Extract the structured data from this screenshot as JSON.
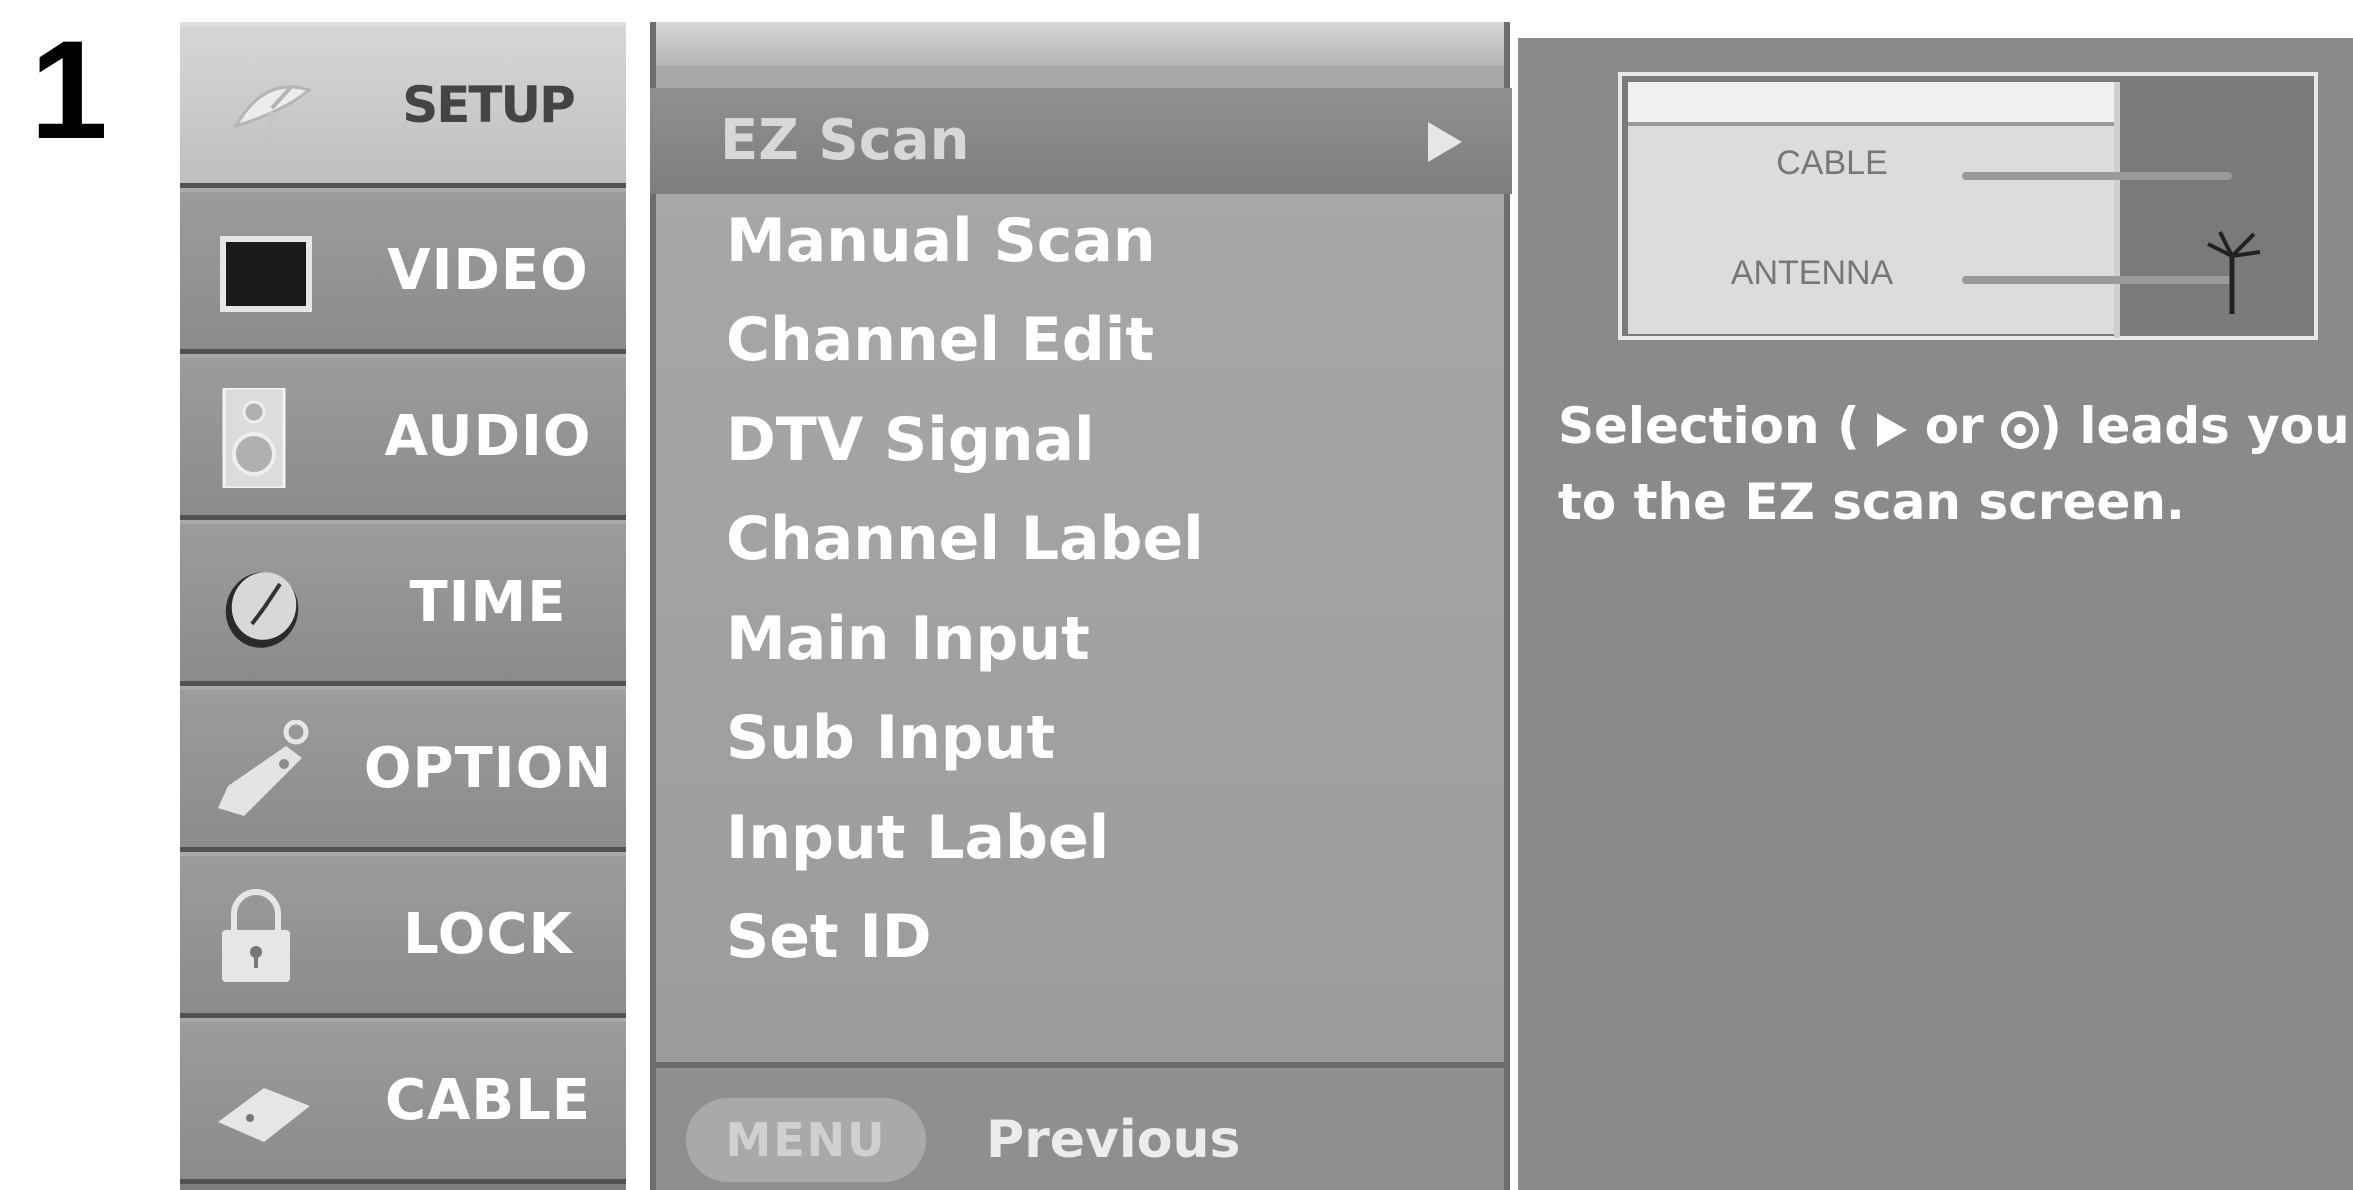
{
  "step_number": "1",
  "sidebar": {
    "items": [
      {
        "label": "SETUP",
        "icon": "satellite-dish-icon",
        "selected": true
      },
      {
        "label": "VIDEO",
        "icon": "monitor-icon",
        "selected": false
      },
      {
        "label": "AUDIO",
        "icon": "speaker-icon",
        "selected": false
      },
      {
        "label": "TIME",
        "icon": "clock-icon",
        "selected": false
      },
      {
        "label": "OPTION",
        "icon": "tag-icon",
        "selected": false
      },
      {
        "label": "LOCK",
        "icon": "padlock-icon",
        "selected": false
      },
      {
        "label": "CABLE",
        "icon": "card-icon",
        "selected": false
      }
    ]
  },
  "submenu": {
    "highlighted": {
      "label": "EZ Scan",
      "icon": "right-arrow-icon"
    },
    "items": [
      {
        "label": "Manual Scan"
      },
      {
        "label": "Channel Edit"
      },
      {
        "label": "DTV Signal"
      },
      {
        "label": "Channel Label"
      },
      {
        "label": "Main Input"
      },
      {
        "label": "Sub Input"
      },
      {
        "label": "Input Label"
      },
      {
        "label": "Set ID"
      }
    ],
    "footer": {
      "button_label": "MENU",
      "action_label": "Previous"
    }
  },
  "info_panel": {
    "diagram": {
      "cable_label": "CABLE",
      "antenna_label": "ANTENNA"
    },
    "description": {
      "line1_start": "Selection (",
      "line1_or": "or",
      "line1_end": ") leads you",
      "line2": "to the EZ scan screen."
    }
  },
  "colors": {
    "panel_gray": "#8a8a8a",
    "menu_gray": "#9c9c9c",
    "selected_light": "#d0d0d0",
    "text_white": "#ffffff"
  }
}
